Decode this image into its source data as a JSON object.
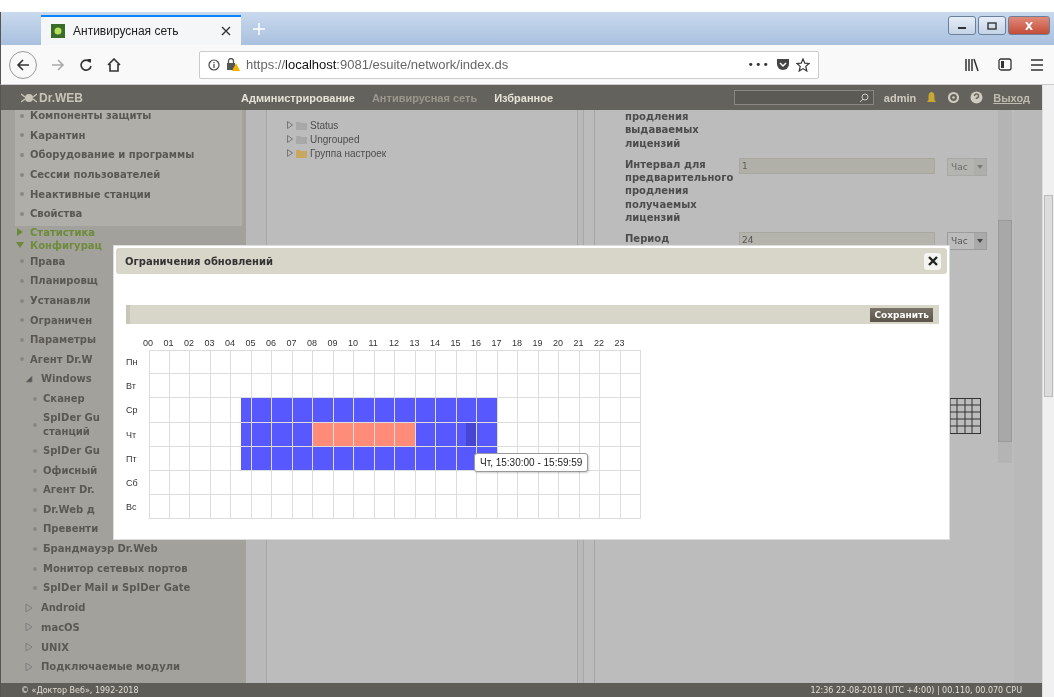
{
  "browser": {
    "tab": {
      "title": "Антивирусная сеть"
    },
    "url": {
      "scheme": "https://",
      "host": "localhost",
      "rest": ":9081/esuite/network/index.ds"
    },
    "more": "•••"
  },
  "header": {
    "logo": "Dr.WEB",
    "nav": [
      {
        "label": "Администрирование",
        "selected": false
      },
      {
        "label": "Антивирусная сеть",
        "selected": true
      },
      {
        "label": "Избранное",
        "selected": false
      }
    ],
    "user": "admin",
    "logout": "Выход"
  },
  "sidebar": {
    "station_items": [
      "Компоненты защиты",
      "Карантин",
      "Оборудование и программы",
      "Сессии пользователей",
      "Неактивные станции",
      "Свойства"
    ],
    "sections": [
      {
        "label": "Статистика",
        "expanded": false
      },
      {
        "label": "Конфигурац",
        "expanded": true
      }
    ],
    "config_items": [
      {
        "kind": "leaf",
        "label": "Права"
      },
      {
        "kind": "leaf",
        "label": "Планировщ"
      },
      {
        "kind": "leaf",
        "label": "Устанавли"
      },
      {
        "kind": "leaf",
        "label": "Ограничен"
      },
      {
        "kind": "leaf",
        "label": "Параметры"
      },
      {
        "kind": "leaf",
        "label": "Агент Dr.W"
      },
      {
        "kind": "group",
        "label": "Windows",
        "expanded": true,
        "children": [
          {
            "label": "Сканер"
          },
          {
            "label": "SpIDer Gu",
            "continuation": "станций"
          },
          {
            "label": "SpIDer Gu"
          },
          {
            "label": "Офисный"
          },
          {
            "label": "Агент Dr."
          },
          {
            "label": "Dr.Web д"
          },
          {
            "label": "Превенти"
          },
          {
            "label": "Брандмауэр Dr.Web"
          },
          {
            "label": "Монитор сетевых портов"
          },
          {
            "label": "SpIDer Mail и SpIDer Gate"
          }
        ]
      },
      {
        "kind": "group",
        "label": "Android",
        "expanded": false
      },
      {
        "kind": "group",
        "label": "macOS",
        "expanded": false
      },
      {
        "kind": "group",
        "label": "UNIX",
        "expanded": false
      },
      {
        "kind": "group",
        "label": "Подключаемые модули",
        "expanded": false
      }
    ]
  },
  "tree": [
    {
      "label": "Status",
      "color": "#a8a8a8"
    },
    {
      "label": "Ungrouped",
      "color": "#a8a8a8"
    },
    {
      "label": "Группа настроек",
      "color": "#c8a860"
    }
  ],
  "form": {
    "top_label": "продления выдаваемых лицензий",
    "fields": [
      {
        "label": "Интервал для предварительного продления получаемых лицензий",
        "value": "1",
        "unit": "Час",
        "disabled": true
      },
      {
        "label": "Период",
        "value": "24",
        "unit": "Час",
        "disabled": false
      }
    ]
  },
  "modal": {
    "title": "Ограничения обновлений",
    "save": "Сохранить",
    "hours": [
      "00",
      "01",
      "02",
      "03",
      "04",
      "05",
      "06",
      "07",
      "08",
      "09",
      "10",
      "11",
      "12",
      "13",
      "14",
      "15",
      "16",
      "17",
      "18",
      "19",
      "20",
      "21",
      "22",
      "23"
    ],
    "days": [
      {
        "day": "Пн"
      },
      {
        "day": "Вт"
      },
      {
        "day": "Ср",
        "slots": [
          {
            "kind": "off"
          },
          {
            "kind": "off"
          },
          {
            "kind": "off"
          },
          {
            "kind": "off"
          },
          {
            "kind": "off"
          },
          {
            "kind": "off"
          },
          {
            "kind": "off"
          },
          {
            "kind": "off"
          },
          {
            "kind": "off"
          },
          {
            "kind": "allowed"
          },
          {
            "kind": "allowed"
          },
          {
            "kind": "allowed"
          },
          {
            "kind": "allowed"
          },
          {
            "kind": "allowed"
          },
          {
            "kind": "allowed"
          },
          {
            "kind": "allowed"
          },
          {
            "kind": "allowed"
          },
          {
            "kind": "allowed"
          },
          {
            "kind": "allowed"
          },
          {
            "kind": "allowed"
          },
          {
            "kind": "allowed"
          },
          {
            "kind": "allowed"
          },
          {
            "kind": "allowed"
          },
          {
            "kind": "allowed"
          },
          {
            "kind": "allowed"
          },
          {
            "kind": "allowed"
          },
          {
            "kind": "allowed"
          },
          {
            "kind": "allowed"
          },
          {
            "kind": "allowed"
          },
          {
            "kind": "allowed"
          },
          {
            "kind": "allowed"
          },
          {
            "kind": "allowed"
          },
          {
            "kind": "allowed"
          },
          {
            "kind": "allowed"
          },
          {
            "kind": "off"
          },
          {
            "kind": "off"
          },
          {
            "kind": "off"
          },
          {
            "kind": "off"
          },
          {
            "kind": "off"
          },
          {
            "kind": "off"
          },
          {
            "kind": "off"
          },
          {
            "kind": "off"
          },
          {
            "kind": "off"
          },
          {
            "kind": "off"
          },
          {
            "kind": "off"
          },
          {
            "kind": "off"
          },
          {
            "kind": "off"
          },
          {
            "kind": "off"
          }
        ]
      },
      {
        "day": "Чт",
        "slots": [
          {
            "kind": "off"
          },
          {
            "kind": "off"
          },
          {
            "kind": "off"
          },
          {
            "kind": "off"
          },
          {
            "kind": "off"
          },
          {
            "kind": "off"
          },
          {
            "kind": "off"
          },
          {
            "kind": "off"
          },
          {
            "kind": "off"
          },
          {
            "kind": "allowed"
          },
          {
            "kind": "allowed"
          },
          {
            "kind": "allowed"
          },
          {
            "kind": "allowed"
          },
          {
            "kind": "allowed"
          },
          {
            "kind": "allowed"
          },
          {
            "kind": "allowed"
          },
          {
            "kind": "restricted"
          },
          {
            "kind": "restricted"
          },
          {
            "kind": "restricted"
          },
          {
            "kind": "restricted"
          },
          {
            "kind": "restricted"
          },
          {
            "kind": "restricted"
          },
          {
            "kind": "restricted"
          },
          {
            "kind": "restricted"
          },
          {
            "kind": "restricted"
          },
          {
            "kind": "restricted"
          },
          {
            "kind": "allowed"
          },
          {
            "kind": "allowed"
          },
          {
            "kind": "allowed"
          },
          {
            "kind": "allowed"
          },
          {
            "kind": "allowed"
          },
          {
            "kind": "hovered"
          },
          {
            "kind": "allowed"
          },
          {
            "kind": "allowed"
          },
          {
            "kind": "off"
          },
          {
            "kind": "off"
          },
          {
            "kind": "off"
          },
          {
            "kind": "off"
          },
          {
            "kind": "off"
          },
          {
            "kind": "off"
          },
          {
            "kind": "off"
          },
          {
            "kind": "off"
          },
          {
            "kind": "off"
          },
          {
            "kind": "off"
          },
          {
            "kind": "off"
          },
          {
            "kind": "off"
          },
          {
            "kind": "off"
          },
          {
            "kind": "off"
          }
        ]
      },
      {
        "day": "Пт",
        "slots": [
          {
            "kind": "off"
          },
          {
            "kind": "off"
          },
          {
            "kind": "off"
          },
          {
            "kind": "off"
          },
          {
            "kind": "off"
          },
          {
            "kind": "off"
          },
          {
            "kind": "off"
          },
          {
            "kind": "off"
          },
          {
            "kind": "off"
          },
          {
            "kind": "allowed"
          },
          {
            "kind": "allowed"
          },
          {
            "kind": "allowed"
          },
          {
            "kind": "allowed"
          },
          {
            "kind": "allowed"
          },
          {
            "kind": "allowed"
          },
          {
            "kind": "allowed"
          },
          {
            "kind": "allowed"
          },
          {
            "kind": "allowed"
          },
          {
            "kind": "allowed"
          },
          {
            "kind": "allowed"
          },
          {
            "kind": "allowed"
          },
          {
            "kind": "allowed"
          },
          {
            "kind": "allowed"
          },
          {
            "kind": "allowed"
          },
          {
            "kind": "allowed"
          },
          {
            "kind": "allowed"
          },
          {
            "kind": "allowed"
          },
          {
            "kind": "allowed"
          },
          {
            "kind": "allowed"
          },
          {
            "kind": "allowed"
          },
          {
            "kind": "allowed"
          },
          {
            "kind": "allowed"
          },
          {
            "kind": "allowed"
          },
          {
            "kind": "allowed"
          },
          {
            "kind": "off"
          },
          {
            "kind": "off"
          },
          {
            "kind": "off"
          },
          {
            "kind": "off"
          },
          {
            "kind": "off"
          },
          {
            "kind": "off"
          },
          {
            "kind": "off"
          },
          {
            "kind": "off"
          },
          {
            "kind": "off"
          },
          {
            "kind": "off"
          },
          {
            "kind": "off"
          },
          {
            "kind": "off"
          },
          {
            "kind": "off"
          },
          {
            "kind": "off"
          }
        ]
      },
      {
        "day": "Сб"
      },
      {
        "day": "Вс"
      }
    ],
    "tooltip": "Чт, 15:30:00 - 15:59:59"
  },
  "footer": {
    "copyright": "© «Доктор Веб», 1992-2018",
    "status": "12:36 22-08-2018 (UTC +4:00) | 00.110, 00.070 CPU"
  }
}
